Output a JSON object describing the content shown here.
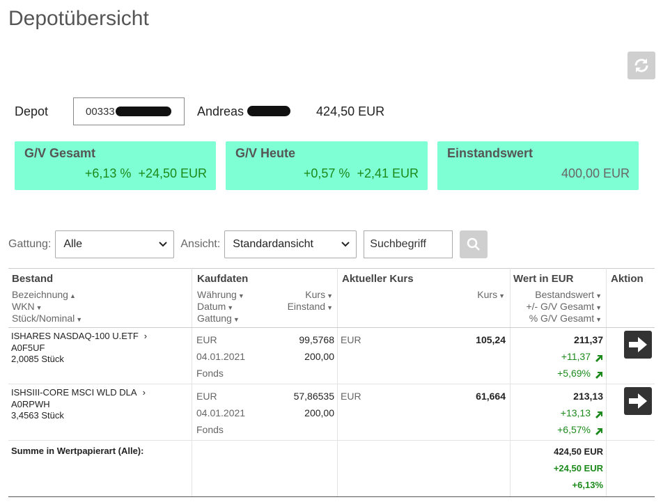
{
  "page": {
    "title": "Depotübersicht"
  },
  "depot": {
    "label": "Depot",
    "number_visible": "00333",
    "owner_visible": "Andreas",
    "total": "424,50 EUR"
  },
  "kpis": [
    {
      "title": "G/V Gesamt",
      "pct": "+6,13 %",
      "amount": "+24,50 EUR"
    },
    {
      "title": "G/V Heute",
      "pct": "+0,57 %",
      "amount": "+2,41 EUR"
    },
    {
      "title": "Einstandswert",
      "amount": "400,00 EUR"
    }
  ],
  "filters": {
    "gattung_label": "Gattung:",
    "gattung_value": "Alle",
    "ansicht_label": "Ansicht:",
    "ansicht_value": "Standardansicht",
    "search_placeholder": "Suchbegriff"
  },
  "table": {
    "headers": {
      "bestand": "Bestand",
      "kaufdaten": "Kaufdaten",
      "aktueller_kurs": "Aktueller Kurs",
      "wert": "Wert in EUR",
      "aktion": "Aktion"
    },
    "subheaders": {
      "bezeichnung": "Bezeichnung",
      "wkn": "WKN",
      "stueck": "Stück/Nominal",
      "waehrung": "Währung",
      "datum": "Datum",
      "gattung": "Gattung",
      "kurs": "Kurs",
      "einstand": "Einstand",
      "akt_kurs": "Kurs",
      "bestandswert": "Bestandswert",
      "gv_gesamt": "+/- G/V Gesamt",
      "pct_gv": "% G/V Gesamt"
    },
    "rows": [
      {
        "name": "ISHARES NASDAQ-100 U.ETF",
        "wkn": "A0F5UF",
        "qty": "2,0085 Stück",
        "currency": "EUR",
        "date": "04.01.2021",
        "type": "Fonds",
        "buy_price": "99,5768",
        "cost": "200,00",
        "cur_currency": "EUR",
        "cur_price": "105,24",
        "value": "211,37",
        "gain": "+11,37",
        "gain_pct": "+5,69%"
      },
      {
        "name": "ISHSIII-CORE MSCI WLD DLA",
        "wkn": "A0RPWH",
        "qty": "3,4563 Stück",
        "currency": "EUR",
        "date": "04.01.2021",
        "type": "Fonds",
        "buy_price": "57,86535",
        "cost": "200,00",
        "cur_currency": "EUR",
        "cur_price": "61,664",
        "value": "213,13",
        "gain": "+13,13",
        "gain_pct": "+6,57%"
      }
    ],
    "summary": {
      "label": "Summe in Wertpapierart (Alle):",
      "value": "424,50 EUR",
      "gain": "+24,50 EUR",
      "gain_pct": "+6,13%"
    }
  },
  "colors": {
    "kpi_bg": "#7fffd4",
    "positive": "#1b8a1b",
    "button_gray": "#cfcfcf",
    "action_dark": "#333333"
  },
  "icons": [
    "refresh-icon",
    "search-icon",
    "arrow-right-icon",
    "trend-up-icon",
    "sort-asc-icon",
    "sort-desc-icon",
    "chevron-down-icon",
    "chevron-right-icon"
  ]
}
